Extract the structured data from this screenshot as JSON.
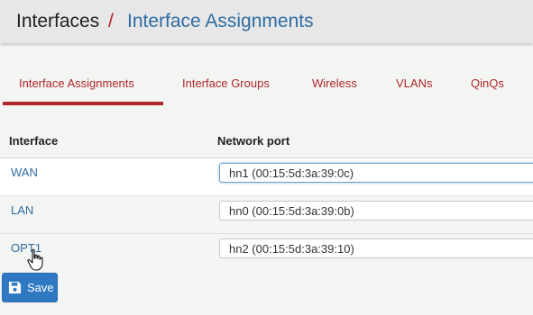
{
  "breadcrumb": {
    "root": "Interfaces",
    "separator": "/",
    "current": "Interface Assignments"
  },
  "tabs": [
    {
      "label": "Interface Assignments",
      "active": true
    },
    {
      "label": "Interface Groups",
      "active": false
    },
    {
      "label": "Wireless",
      "active": false
    },
    {
      "label": "VLANs",
      "active": false
    },
    {
      "label": "QinQs",
      "active": false
    }
  ],
  "table": {
    "headers": {
      "interface": "Interface",
      "network_port": "Network port"
    },
    "rows": [
      {
        "interface": "WAN",
        "port": "hn1 (00:15:5d:3a:39:0c)"
      },
      {
        "interface": "LAN",
        "port": "hn0 (00:15:5d:3a:39:0b)"
      },
      {
        "interface": "OPT1",
        "port": "hn2 (00:15:5d:3a:39:10)"
      }
    ]
  },
  "save_button": {
    "label": "Save",
    "icon": "floppy-disk-icon"
  },
  "colors": {
    "accent": "#b0262a",
    "link": "#2e6da4",
    "button": "#2f78c2"
  }
}
